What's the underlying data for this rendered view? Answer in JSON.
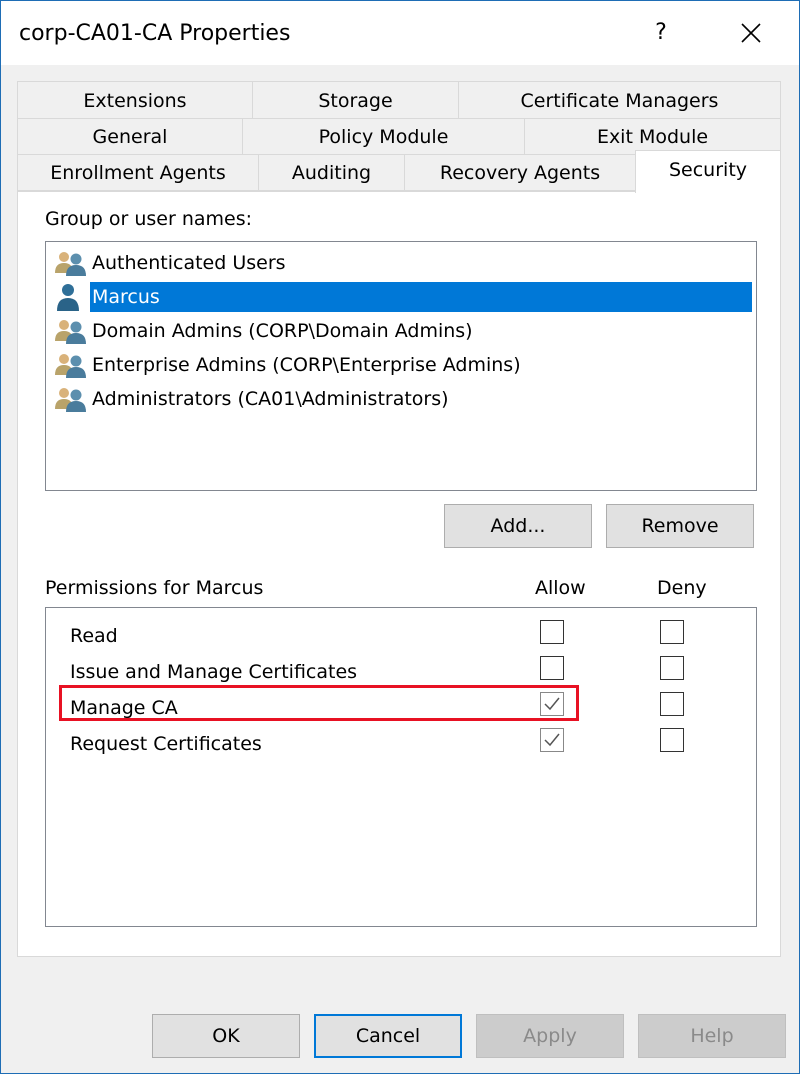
{
  "window": {
    "title": "corp-CA01-CA Properties",
    "help_label": "?",
    "close_icon": "close-icon"
  },
  "tabs": {
    "row1": [
      "Extensions",
      "Storage",
      "Certificate Managers"
    ],
    "row2": [
      "General",
      "Policy Module",
      "Exit Module"
    ],
    "row3": [
      "Enrollment Agents",
      "Auditing",
      "Recovery Agents",
      "Security"
    ],
    "active": "Security"
  },
  "security": {
    "group_label": "Group or user names:",
    "users": [
      {
        "name": "Authenticated Users",
        "icon": "group-icon",
        "selected": false
      },
      {
        "name": "Marcus",
        "icon": "user-icon",
        "selected": true
      },
      {
        "name": "Domain Admins (CORP\\Domain Admins)",
        "icon": "group-icon",
        "selected": false
      },
      {
        "name": "Enterprise Admins (CORP\\Enterprise Admins)",
        "icon": "group-icon",
        "selected": false
      },
      {
        "name": "Administrators (CA01\\Administrators)",
        "icon": "group-icon",
        "selected": false
      }
    ],
    "add_label": "Add...",
    "remove_label": "Remove",
    "permissions_label": "Permissions for Marcus",
    "allow_label": "Allow",
    "deny_label": "Deny",
    "permissions": [
      {
        "name": "Read",
        "allow": false,
        "deny": false
      },
      {
        "name": "Issue and Manage Certificates",
        "allow": false,
        "deny": false
      },
      {
        "name": "Manage CA",
        "allow": true,
        "deny": false,
        "highlighted": true
      },
      {
        "name": "Request Certificates",
        "allow": true,
        "deny": false
      }
    ]
  },
  "footer": {
    "ok_label": "OK",
    "cancel_label": "Cancel",
    "apply_label": "Apply",
    "help_label": "Help"
  },
  "colors": {
    "selection": "#0078d7",
    "highlight": "#e81123",
    "border": "#1e6db5"
  }
}
